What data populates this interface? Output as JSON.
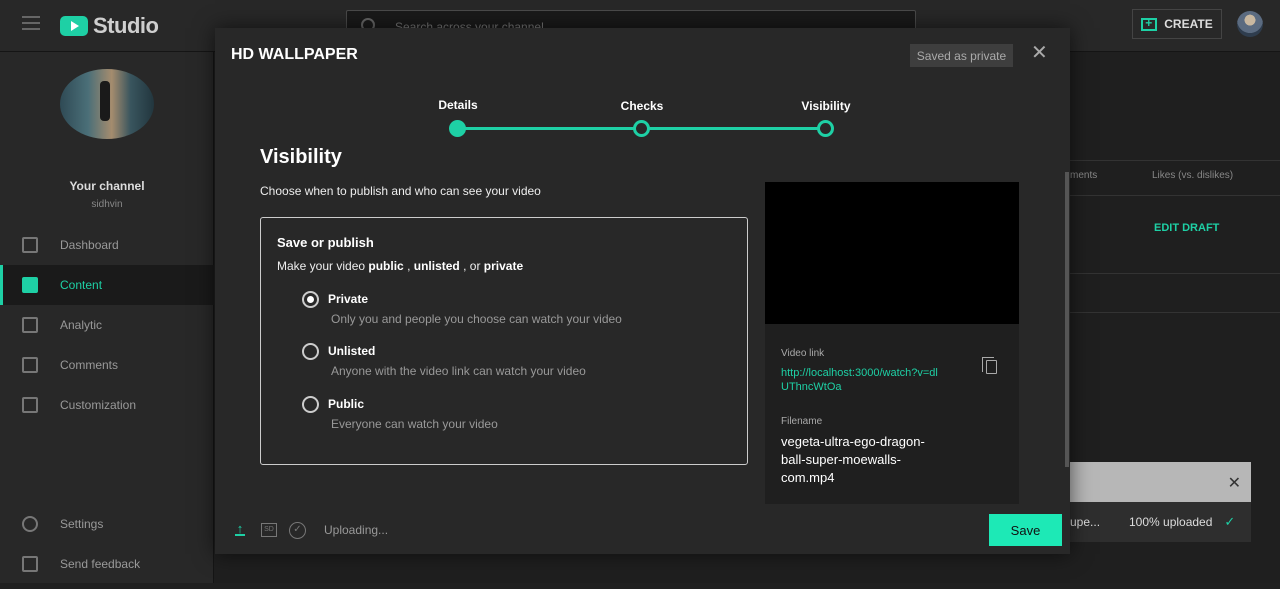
{
  "app": {
    "logo_text": "Studio"
  },
  "search": {
    "placeholder": "Search across your channel"
  },
  "header": {
    "create_label": "CREATE"
  },
  "sidebar": {
    "channel_title": "Your channel",
    "channel_name": "sidhvin",
    "items": [
      {
        "label": "Dashboard",
        "icon": "dashboard-icon",
        "active": false
      },
      {
        "label": "Content",
        "icon": "content-icon",
        "active": true
      },
      {
        "label": "Analytic",
        "icon": "analytics-icon",
        "active": false
      },
      {
        "label": "Comments",
        "icon": "comments-icon",
        "active": false
      },
      {
        "label": "Customization",
        "icon": "customization-icon",
        "active": false
      }
    ],
    "bottom_items": [
      {
        "label": "Settings",
        "icon": "gear-icon"
      },
      {
        "label": "Send feedback",
        "icon": "feedback-icon"
      }
    ]
  },
  "background": {
    "col_comments": "ments",
    "col_likes": "Likes (vs. dislikes)",
    "edit_draft": "EDIT DRAFT"
  },
  "toast": {
    "file_short": "upe...",
    "progress": "100% uploaded"
  },
  "modal": {
    "title": "HD WALLPAPER",
    "saved_badge": "Saved as private",
    "steps": [
      {
        "label": "Details",
        "state": "complete"
      },
      {
        "label": "Checks",
        "state": "complete"
      },
      {
        "label": "Visibility",
        "state": "current"
      }
    ],
    "section_title": "Visibility",
    "section_sub": "Choose when to publish and who can see your video",
    "publish": {
      "title": "Save or publish",
      "sub_prefix": "Make your video ",
      "sub_public": "public",
      "sub_sep1": " , ",
      "sub_unlisted": "unlisted",
      "sub_sep2": " , or ",
      "sub_private": "private",
      "options": [
        {
          "label": "Private",
          "desc": "Only you and people you choose can watch your video",
          "checked": true
        },
        {
          "label": "Unlisted",
          "desc": "Anyone with the video link can watch your video",
          "checked": false
        },
        {
          "label": "Public",
          "desc": "Everyone can watch your video",
          "checked": false
        }
      ]
    },
    "preview": {
      "video_link_label": "Video link",
      "video_link": "http://localhost:3000/watch?v=dlUThncWtOa",
      "filename_label": "Filename",
      "filename": "vegeta-ultra-ego-dragon-ball-super-moewalls-com.mp4"
    },
    "footer": {
      "sd_label": "SD",
      "status": "Uploading...",
      "save_label": "Save"
    }
  },
  "colors": {
    "accent": "#1ed0a5",
    "save_button": "#1de9b6"
  }
}
